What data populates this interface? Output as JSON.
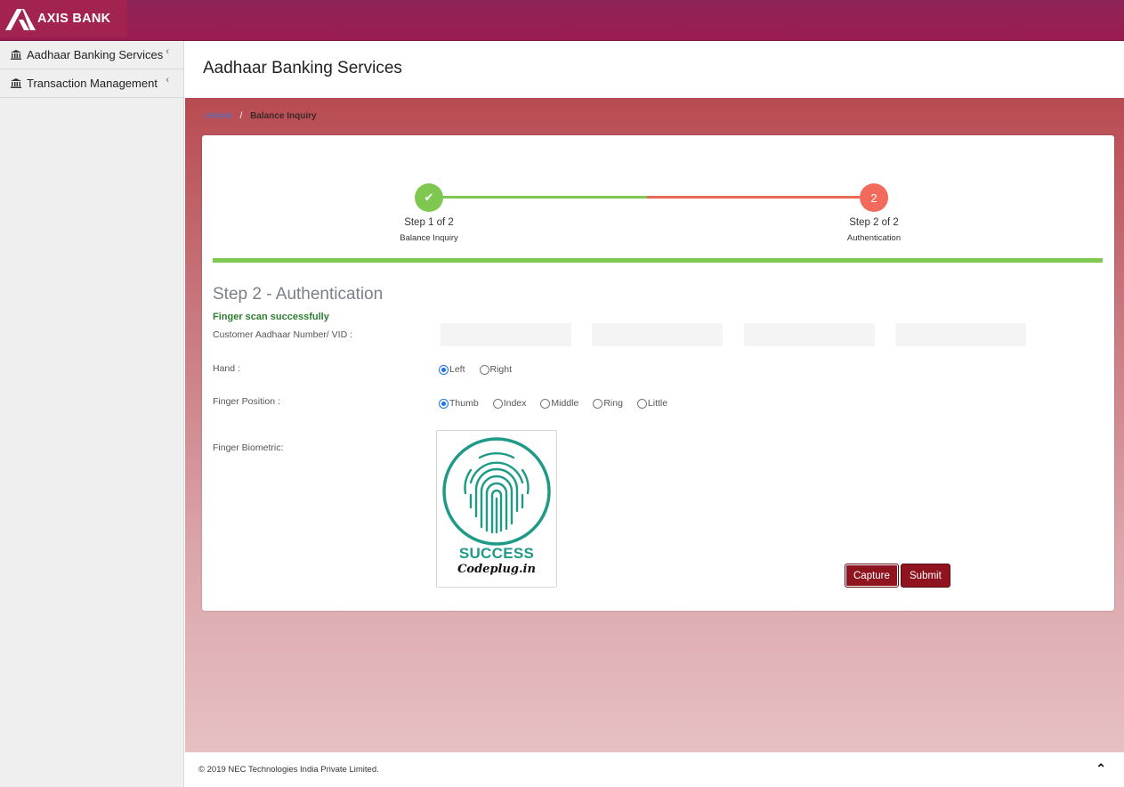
{
  "brand": {
    "name": "AXIS BANK"
  },
  "sidebar": {
    "items": [
      {
        "label": "Aadhaar Banking Services",
        "icon": "bank-icon"
      },
      {
        "label": "Transaction Management",
        "icon": "bank-icon"
      }
    ]
  },
  "header": {
    "title": "Aadhaar Banking Services"
  },
  "breadcrumb": {
    "home": "Home",
    "current": "Balance Inquiry"
  },
  "stepper": {
    "steps": [
      {
        "label": "Step 1 of 2",
        "sub": "Balance Inquiry",
        "status": "done"
      },
      {
        "label": "Step 2 of 2",
        "sub": "Authentication",
        "number": "2",
        "status": "active"
      }
    ]
  },
  "form": {
    "title": "Step 2 - Authentication",
    "success_message": "Finger scan successfully",
    "aadhaar_label": "Customer Aadhaar Number/ VID :",
    "aadhaar_values": [
      "",
      "",
      "",
      ""
    ],
    "hand_label": "Hand :",
    "hand_options": [
      "Left",
      "Right"
    ],
    "hand_selected": "Left",
    "finger_label": "Finger Position :",
    "finger_options": [
      "Thumb",
      "Index",
      "Middle",
      "Ring",
      "Little"
    ],
    "finger_selected": "Thumb",
    "biometric_label": "Finger Biometric:",
    "biometric_status": "SUCCESS",
    "biometric_brand": "Codeplug.in",
    "capture_label": "Capture",
    "submit_label": "Submit"
  },
  "footer": {
    "copyright": "© 2019 NEC Technologies India Private Limited."
  },
  "colors": {
    "topbar": "#9a1c4f",
    "step_done": "#7ec852",
    "step_active": "#f26a5b",
    "button": "#8f1420",
    "success_text": "#2e7d32"
  }
}
